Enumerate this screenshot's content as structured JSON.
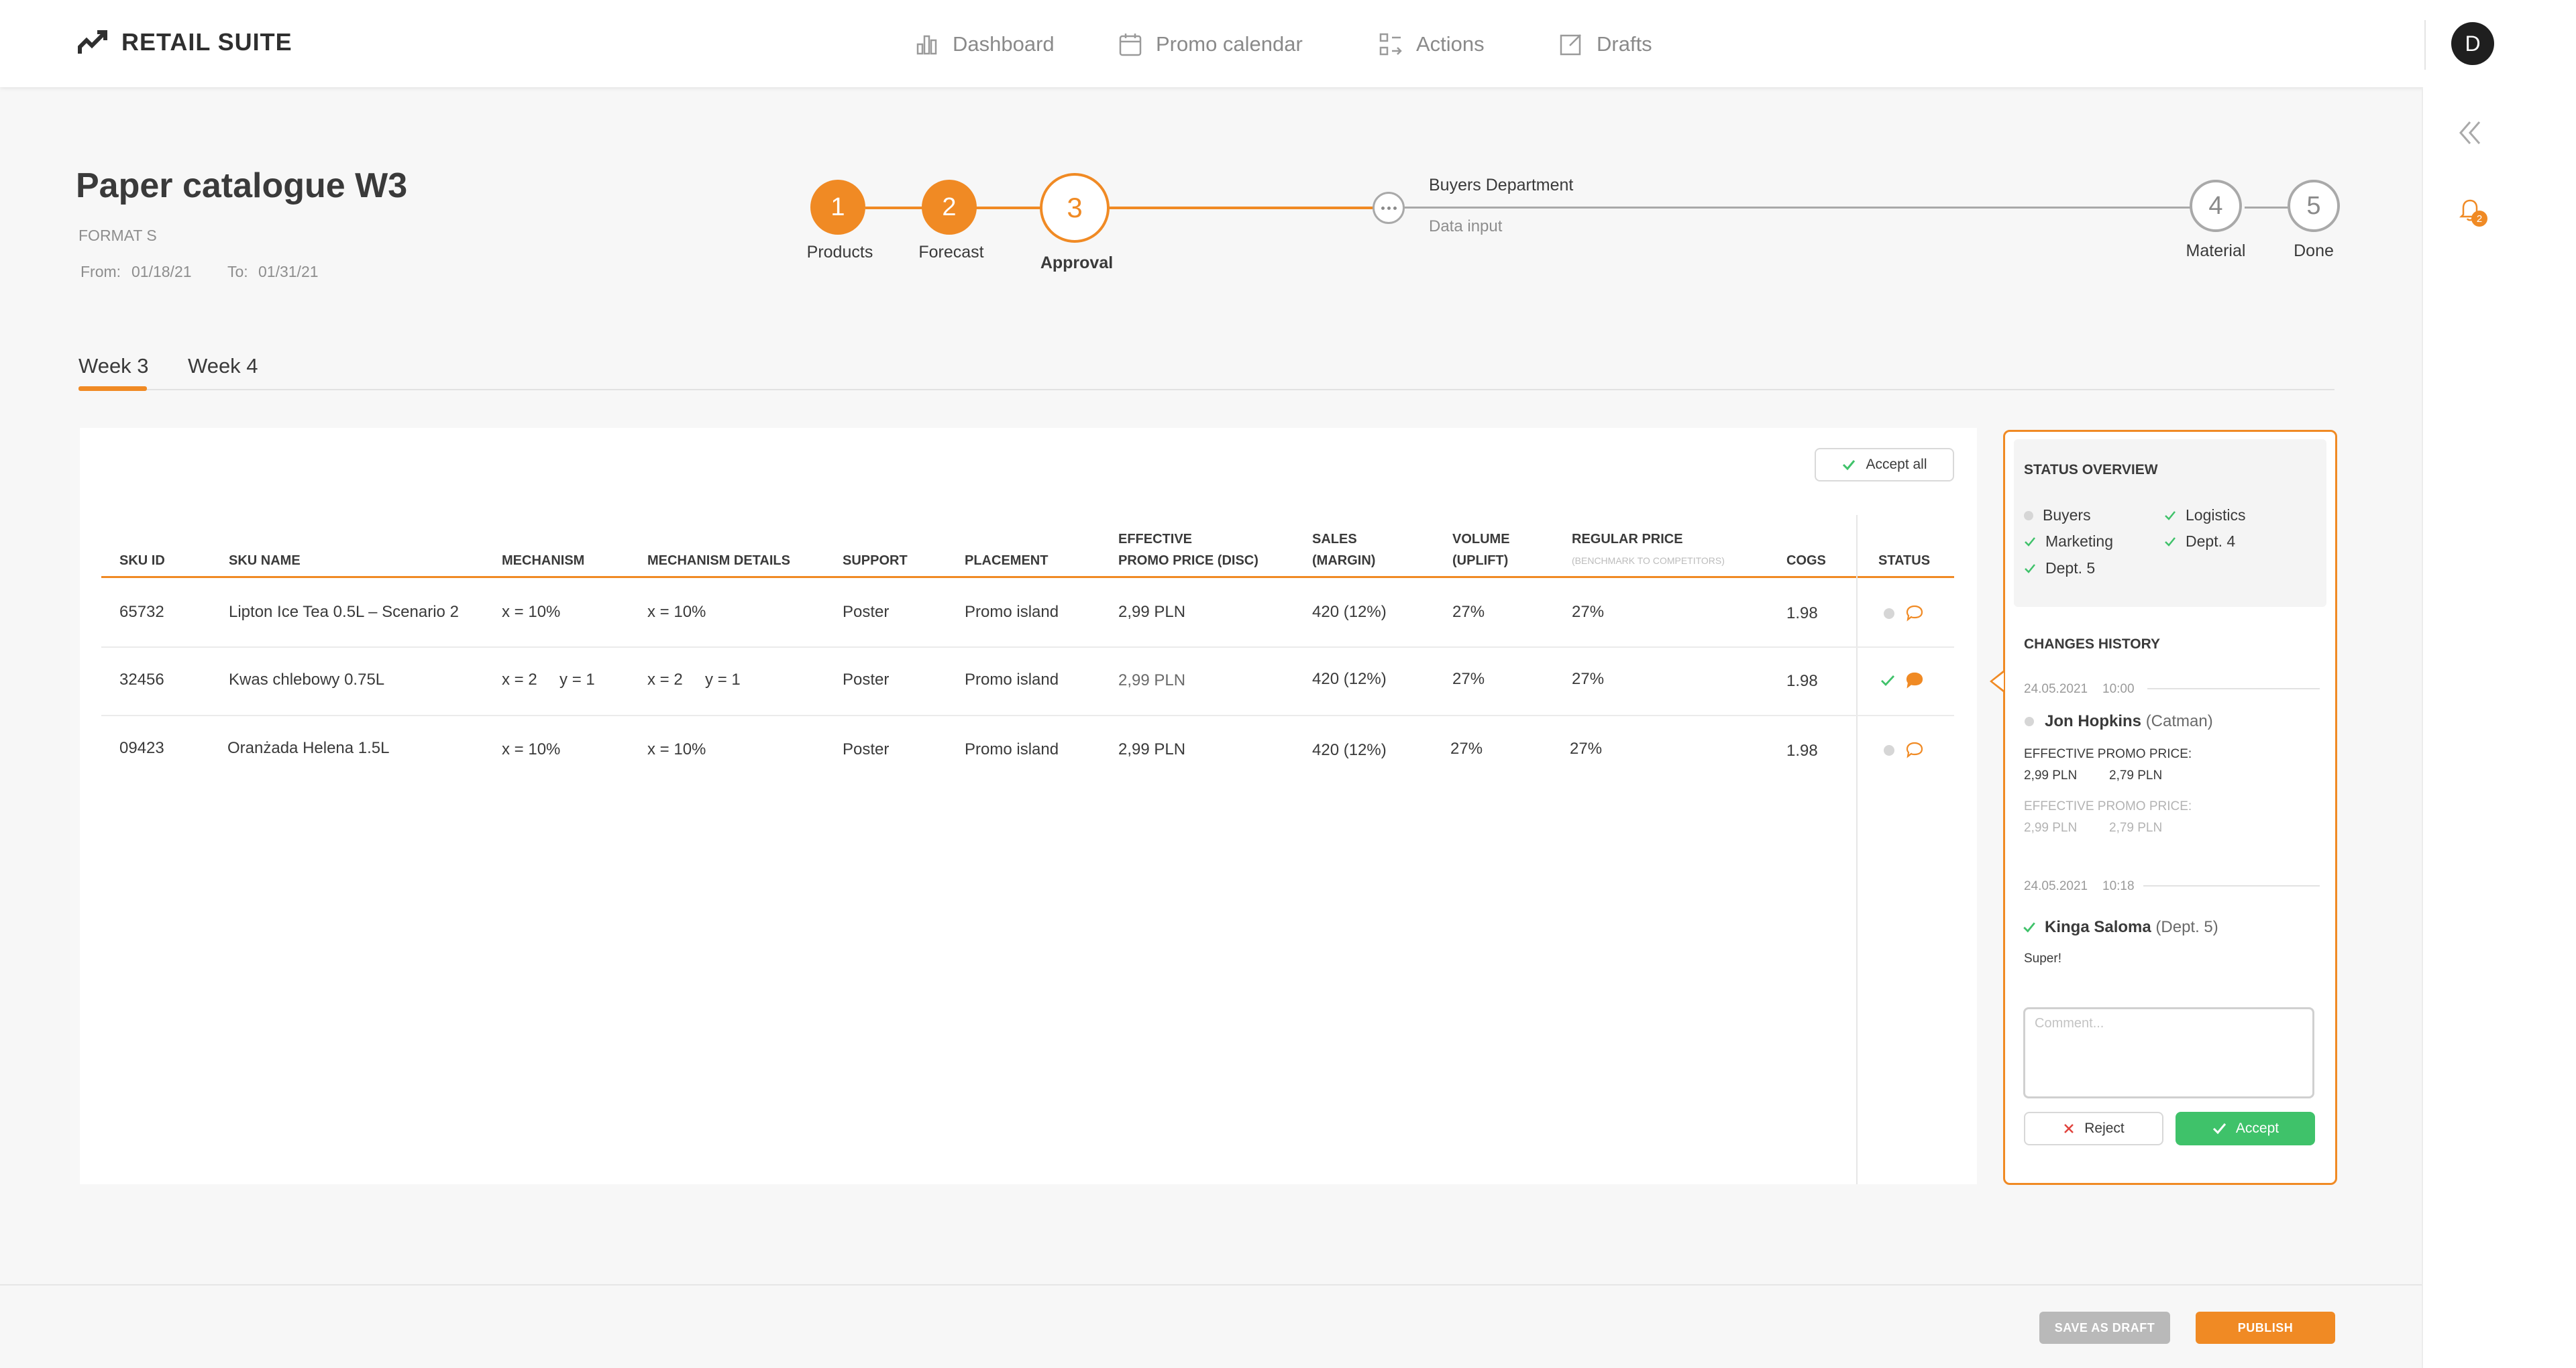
{
  "app": {
    "brand": "RETAIL SUITE",
    "avatar_letter": "D",
    "notification_count": "2"
  },
  "nav": [
    {
      "label": "Dashboard",
      "icon": "bar-chart-icon"
    },
    {
      "label": "Promo calendar",
      "icon": "calendar-icon"
    },
    {
      "label": "Actions",
      "icon": "actions-icon"
    },
    {
      "label": "Drafts",
      "icon": "edit-icon"
    }
  ],
  "promo": {
    "title": "Paper catalogue W3",
    "format": "FORMAT S",
    "from_label": "From:",
    "from": "01/18/21",
    "to_label": "To:",
    "to": "01/31/21"
  },
  "stepper": {
    "steps": [
      {
        "num": "1",
        "label": "Products",
        "state": "done"
      },
      {
        "num": "2",
        "label": "Forecast",
        "state": "done"
      },
      {
        "num": "3",
        "label": "Approval",
        "state": "current"
      },
      {
        "num": "4",
        "label": "Material",
        "state": "todo"
      },
      {
        "num": "5",
        "label": "Done",
        "state": "todo"
      }
    ],
    "substep_title": "Buyers Department",
    "substep_subtitle": "Data input"
  },
  "tabs": [
    {
      "label": "Week 3",
      "active": true
    },
    {
      "label": "Week 4",
      "active": false
    }
  ],
  "table": {
    "accept_all": "Accept all",
    "headers": {
      "sku_id": "SKU ID",
      "sku_name": "SKU NAME",
      "mechanism": "MECHANISM",
      "mechanism_details": "MECHANISM DETAILS",
      "support": "SUPPORT",
      "placement": "PLACEMENT",
      "eff_price_1": "EFFECTIVE",
      "eff_price_2": "PROMO PRICE (DISC)",
      "sales_1": "SALES",
      "sales_2": "(MARGIN)",
      "volume_1": "VOLUME",
      "volume_2": "(UPLIFT)",
      "regular_1": "REGULAR PRICE",
      "regular_2": "(BENCHMARK TO COMPETITORS)",
      "cogs": "COGS",
      "status": "STATUS"
    },
    "rows": [
      {
        "sku_id": "65732",
        "sku_name": "Lipton Ice Tea 0.5L – Scenario 2",
        "mechanism": "x = 10%",
        "mechanism_details": "x = 10%",
        "support": "Poster",
        "placement": "Promo island",
        "price": "2,99 PLN",
        "sales": "420 (12%)",
        "volume": "27%",
        "regular": "27%",
        "cogs": "1.98",
        "status": "pending",
        "comment": "outline"
      },
      {
        "sku_id": "32456",
        "sku_name": "Kwas chlebowy 0.75L",
        "mechanism": "x = 2     y = 1",
        "mechanism_details": "x = 2     y = 1",
        "support": "Poster",
        "placement": "Promo island",
        "price": "2,99 PLN",
        "sales": "420 (12%)",
        "volume": "27%",
        "regular": "27%",
        "cogs": "1.98",
        "status": "accepted",
        "comment": "filled"
      },
      {
        "sku_id": "09423",
        "sku_name": "Oranżada Helena 1.5L",
        "mechanism": "x = 10%",
        "mechanism_details": "x = 10%",
        "support": "Poster",
        "placement": "Promo island",
        "price": "2,99 PLN",
        "sales": "420 (12%)",
        "volume": "27%",
        "regular": "27%",
        "cogs": "1.98",
        "status": "pending",
        "comment": "outline"
      }
    ]
  },
  "panel": {
    "status_title": "STATUS OVERVIEW",
    "status_items": [
      {
        "label": "Buyers",
        "state": "pending"
      },
      {
        "label": "Logistics",
        "state": "done"
      },
      {
        "label": "Marketing",
        "state": "done"
      },
      {
        "label": "Dept. 4",
        "state": "done"
      },
      {
        "label": "Dept. 5",
        "state": "done"
      }
    ],
    "history_title": "CHANGES HISTORY",
    "history": [
      {
        "date": "24.05.2021",
        "time": "10:00",
        "name": "Jon Hopkins",
        "role": "(Catman)",
        "change_label": "EFFECTIVE PROMO PRICE:",
        "old_value": "2,99 PLN",
        "new_value": "2,79 PLN",
        "change_label_faded": "EFFECTIVE PROMO PRICE:",
        "old_value_faded": "2,99 PLN",
        "new_value_faded": "2,79 PLN"
      },
      {
        "date": "24.05.2021",
        "time": "10:18",
        "name": "Kinga Saloma",
        "role": "(Dept. 5)",
        "comment": "Super!"
      }
    ],
    "comment_placeholder": "Comment...",
    "reject": "Reject",
    "accept": "Accept"
  },
  "footer": {
    "save_draft": "SAVE AS DRAFT",
    "publish": "PUBLISH"
  },
  "colors": {
    "accent": "#f08a24",
    "success": "#3fc26a",
    "muted": "#a9a9a9"
  }
}
